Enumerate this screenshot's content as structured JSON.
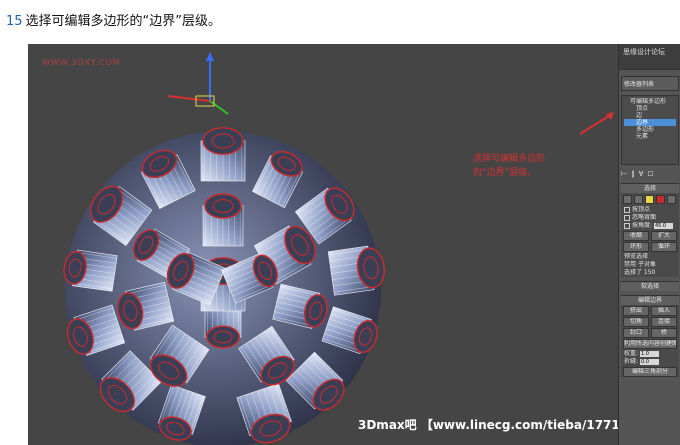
{
  "caption": {
    "step": "15",
    "text": "选择可编辑多边形的“边界”层级。"
  },
  "viewport": {
    "watermark_top": "WWW.3DXY.COM",
    "annotation": "选择可编辑多边形的“边界”层级。",
    "bottom_watermark": "3Dmax吧 【www.linecg.com/tieba/1771】"
  },
  "command_panel": {
    "logo_text": "思缘设计论坛",
    "modifier_list": "修改器列表",
    "stack": [
      "可编辑多边形",
      "顶点",
      "边",
      "边界",
      "多边形",
      "元素"
    ],
    "selected_index": 3,
    "selection_rollout": {
      "title": "选择",
      "by_vertex": "按顶点",
      "ignore_backfacing": "忽略背面",
      "by_angle": "按角度:",
      "angle_value": "45.0",
      "shrink": "收缩",
      "grow": "扩大",
      "ring": "环形",
      "loop": "循环",
      "preview_selection": "预览选择",
      "disabled": "禁用",
      "subobject": "子对象",
      "selected_text": "选择了 150"
    },
    "soft_selection": "软选择",
    "edit_borders": {
      "title": "编辑边界",
      "extrude": "挤出",
      "insert_vertex": "插入",
      "chamfer": "切角",
      "connect": "连接",
      "cap": "封口",
      "bridge": "桥",
      "create_shape": "利用所选内容创建图形",
      "weight_label": "权重:",
      "weight_value": "1.0",
      "crease_label": "折缝:",
      "crease_value": "0.0",
      "edit_tri": "编辑三角剖分"
    }
  },
  "colors": {
    "viewport_bg": "#454545",
    "mesh": "#aab7d6",
    "selection": "#cc2a2a",
    "highlight": "#4b8fd8"
  }
}
